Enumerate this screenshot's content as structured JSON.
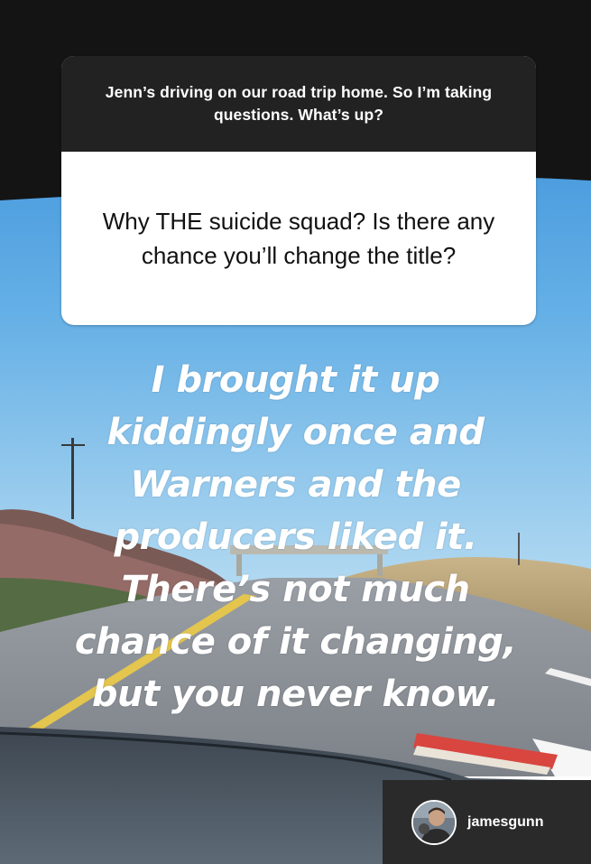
{
  "story": {
    "question_sticker": {
      "prompt": "Jenn’s driving on our road trip home. So I’m taking questions. What’s up?",
      "question": "Why THE suicide squad? Is there any chance you’ll change the title?"
    },
    "answer_lines": [
      "I brought it up",
      "kiddingly once and",
      "Warners and the",
      "producers liked it.",
      "There’s not much",
      "chance of it changing,",
      "but you never know."
    ],
    "account": {
      "username": "jamesgunn",
      "avatar_icon": "profile-photo"
    }
  },
  "colors": {
    "sticker_header": "#222222",
    "sticker_body": "#ffffff",
    "sky": "#5aa8e2",
    "user_bar": "#2a2a2a"
  }
}
